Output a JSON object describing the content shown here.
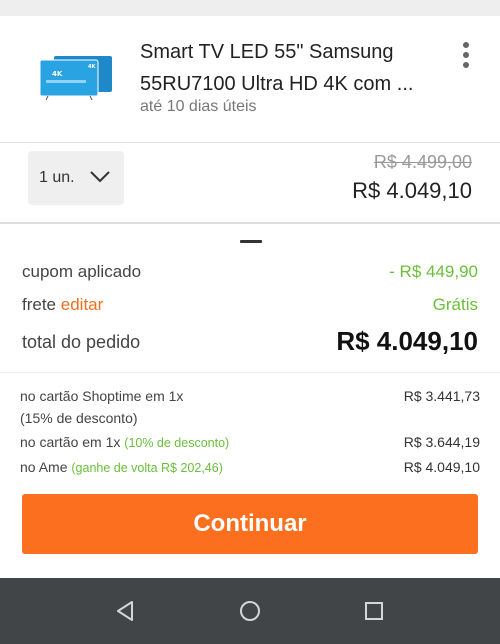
{
  "colors": {
    "accent": "#fc6f1f",
    "link_orange": "#ef6f1f",
    "discount_green": "#6abf3a",
    "nav_bar": "#424548"
  },
  "product": {
    "title_line1": "Smart TV LED 55\" Samsung",
    "title_line2": "55RU7100 Ultra HD 4K com ...",
    "delivery": "até 10 dias úteis",
    "thumbnail_icon": "tv-thumbnail",
    "menu_icon": "kebab-menu-icon",
    "quantity_value": "1 un.",
    "quantity_icon": "chevron-down-icon",
    "old_price": "R$ 4.499,00",
    "price": "R$ 4.049,10"
  },
  "summary": {
    "coupon_label": "cupom aplicado",
    "coupon_value": "- R$ 449,90",
    "shipping_label": "frete",
    "shipping_edit": "editar",
    "shipping_value": "Grátis",
    "total_label": "total do pedido",
    "total_value": "R$ 4.049,10"
  },
  "payment_options": [
    {
      "label": "no cartão Shoptime em 1x",
      "note": "(15% de desconto)",
      "value": "R$ 3.441,73"
    },
    {
      "label": "no cartão em 1x",
      "note": "(10% de desconto)",
      "value": "R$ 3.644,19"
    },
    {
      "label": "no Ame",
      "note": "(ganhe de volta R$ 202,46)",
      "value": "R$ 4.049,10"
    }
  ],
  "cta": {
    "label": "Continuar"
  },
  "navbar": {
    "back_icon": "back-triangle-icon",
    "home_icon": "home-circle-icon",
    "recents_icon": "recents-square-icon"
  }
}
